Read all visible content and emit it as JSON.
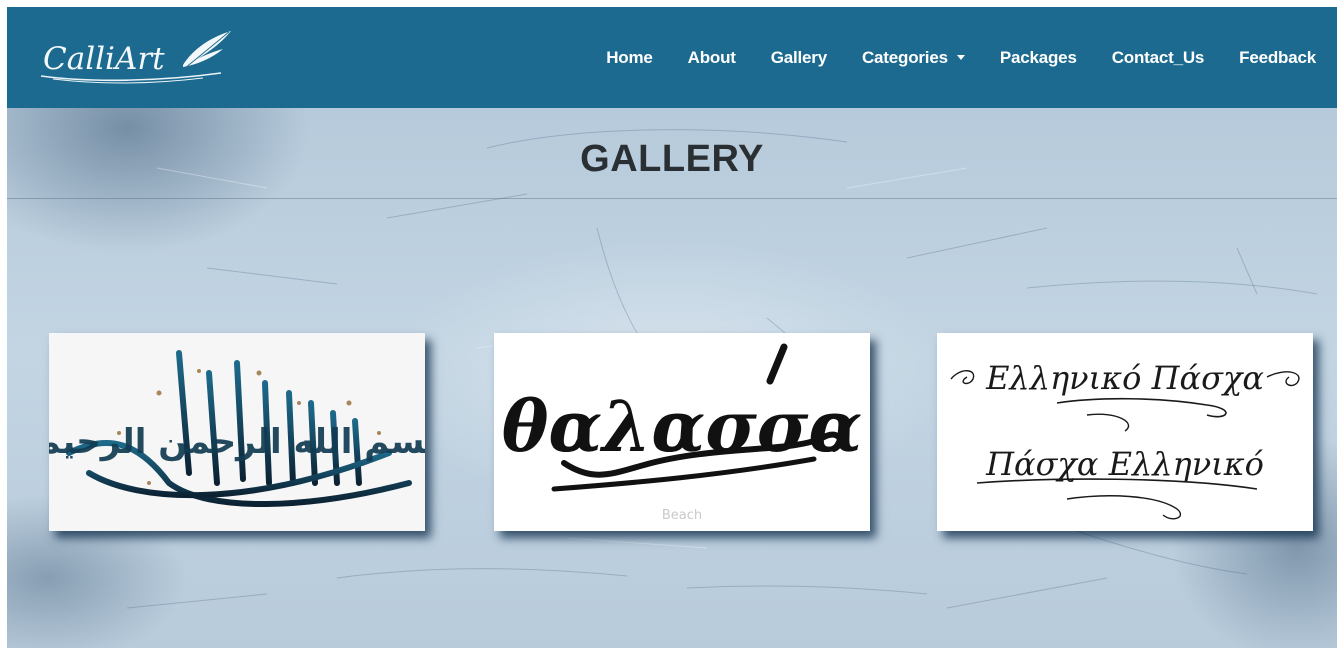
{
  "brand": {
    "logo_text": "CalliArt",
    "logo_icon": "quill-feather-icon"
  },
  "nav": {
    "items": [
      {
        "label": "Home"
      },
      {
        "label": "About"
      },
      {
        "label": "Gallery"
      },
      {
        "label": "Categories",
        "icon": "caret-down-icon"
      },
      {
        "label": "Packages"
      },
      {
        "label": "Contact_Us"
      },
      {
        "label": "Feedback"
      }
    ]
  },
  "gallery": {
    "title": "GALLERY",
    "items": [
      {
        "artwork_text": "بسم الله الرحمن الرحيم"
      },
      {
        "artwork_text": "θαλασσα",
        "caption": "Beach"
      },
      {
        "artwork_text_top": "Ελληνικό Πάσχα",
        "artwork_text_bottom": "Πάσχα Ελληνικό"
      }
    ]
  },
  "colors": {
    "navbar": "#1c6a8f",
    "nav_text": "#ffffff",
    "title_text": "#2a2f33",
    "background": "#c3d5e3"
  }
}
